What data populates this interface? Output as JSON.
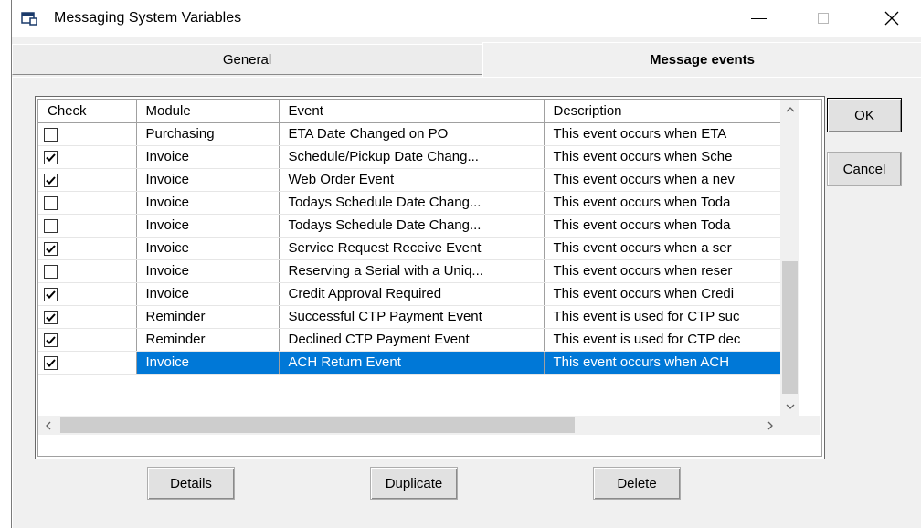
{
  "window": {
    "title": "Messaging System Variables",
    "icon": "app-window-icon"
  },
  "tabs": [
    {
      "label": "General",
      "active": false
    },
    {
      "label": "Message events",
      "active": true
    }
  ],
  "grid": {
    "columns": [
      "Check",
      "Module",
      "Event",
      "Description"
    ],
    "rows": [
      {
        "checked": false,
        "module": "Purchasing",
        "event": "ETA Date Changed on PO",
        "description": "This event occurs when ETA",
        "selected": false
      },
      {
        "checked": true,
        "module": "Invoice",
        "event": "Schedule/Pickup Date Chang...",
        "description": "This event occurs when Sche",
        "selected": false
      },
      {
        "checked": true,
        "module": "Invoice",
        "event": "Web Order Event",
        "description": "This event occurs when a nev",
        "selected": false
      },
      {
        "checked": false,
        "module": "Invoice",
        "event": "Todays Schedule Date Chang...",
        "description": "This event occurs when Toda",
        "selected": false
      },
      {
        "checked": false,
        "module": "Invoice",
        "event": "Todays Schedule Date Chang...",
        "description": "This event occurs when Toda",
        "selected": false
      },
      {
        "checked": true,
        "module": "Invoice",
        "event": "Service Request Receive Event",
        "description": "This event occurs when a ser",
        "selected": false
      },
      {
        "checked": false,
        "module": "Invoice",
        "event": "Reserving a Serial with a Uniq...",
        "description": "This event occurs when reser",
        "selected": false
      },
      {
        "checked": true,
        "module": "Invoice",
        "event": "Credit Approval Required",
        "description": "This event occurs when Credi",
        "selected": false
      },
      {
        "checked": true,
        "module": "Reminder",
        "event": "Successful CTP Payment Event",
        "description": "This event is used for CTP suc",
        "selected": false
      },
      {
        "checked": true,
        "module": "Reminder",
        "event": "Declined CTP Payment Event",
        "description": "This event is used for CTP dec",
        "selected": false
      },
      {
        "checked": true,
        "module": "Invoice",
        "event": "ACH Return Event",
        "description": "This event occurs when ACH",
        "selected": true
      }
    ]
  },
  "buttons": {
    "ok": "OK",
    "cancel": "Cancel",
    "details": "Details",
    "duplicate": "Duplicate",
    "delete": "Delete"
  },
  "colors": {
    "selection": "#0078d7",
    "dialog_bg": "#f0f0f0"
  }
}
